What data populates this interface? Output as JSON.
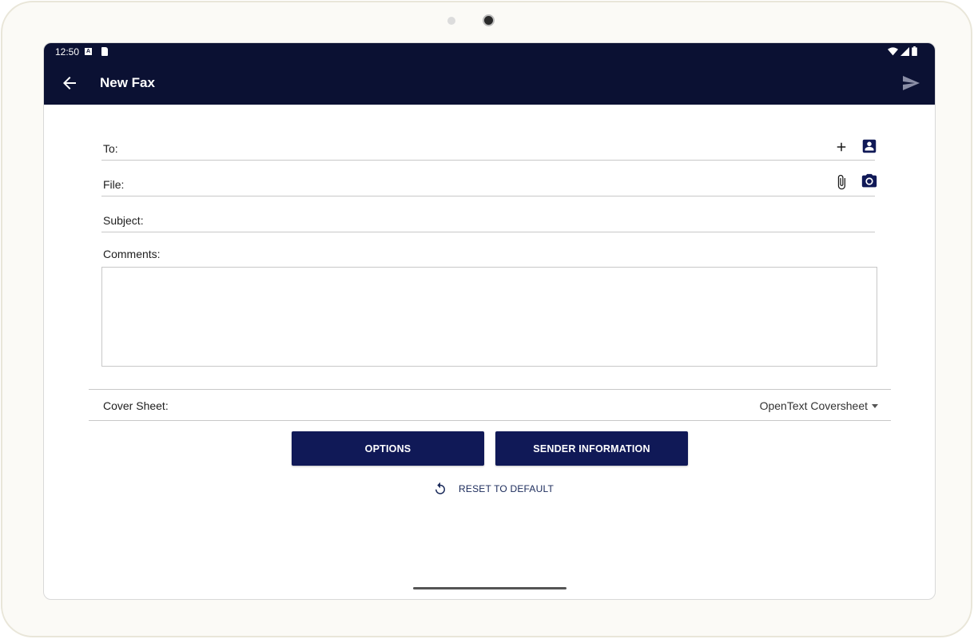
{
  "status_bar": {
    "time": "12:50",
    "a_badge": "A",
    "icons": [
      "a-badge-icon",
      "sd-card-icon",
      "wifi-icon",
      "signal-icon",
      "battery-icon"
    ]
  },
  "app_bar": {
    "title": "New Fax",
    "back_icon": "arrow-back-icon",
    "send_icon": "send-icon",
    "background": "#0b1133"
  },
  "form": {
    "to_label": "To:",
    "file_label": "File:",
    "subject_label": "Subject:",
    "comments_label": "Comments:",
    "comments_value": "",
    "to_icons": [
      "plus-icon",
      "contact-book-icon"
    ],
    "file_icons": [
      "paperclip-icon",
      "camera-icon"
    ]
  },
  "cover_sheet": {
    "label": "Cover Sheet:",
    "selected": "OpenText Coversheet"
  },
  "buttons": {
    "options": "OPTIONS",
    "sender_information": "SENDER INFORMATION",
    "reset": "RESET TO DEFAULT",
    "color": "#101957"
  }
}
